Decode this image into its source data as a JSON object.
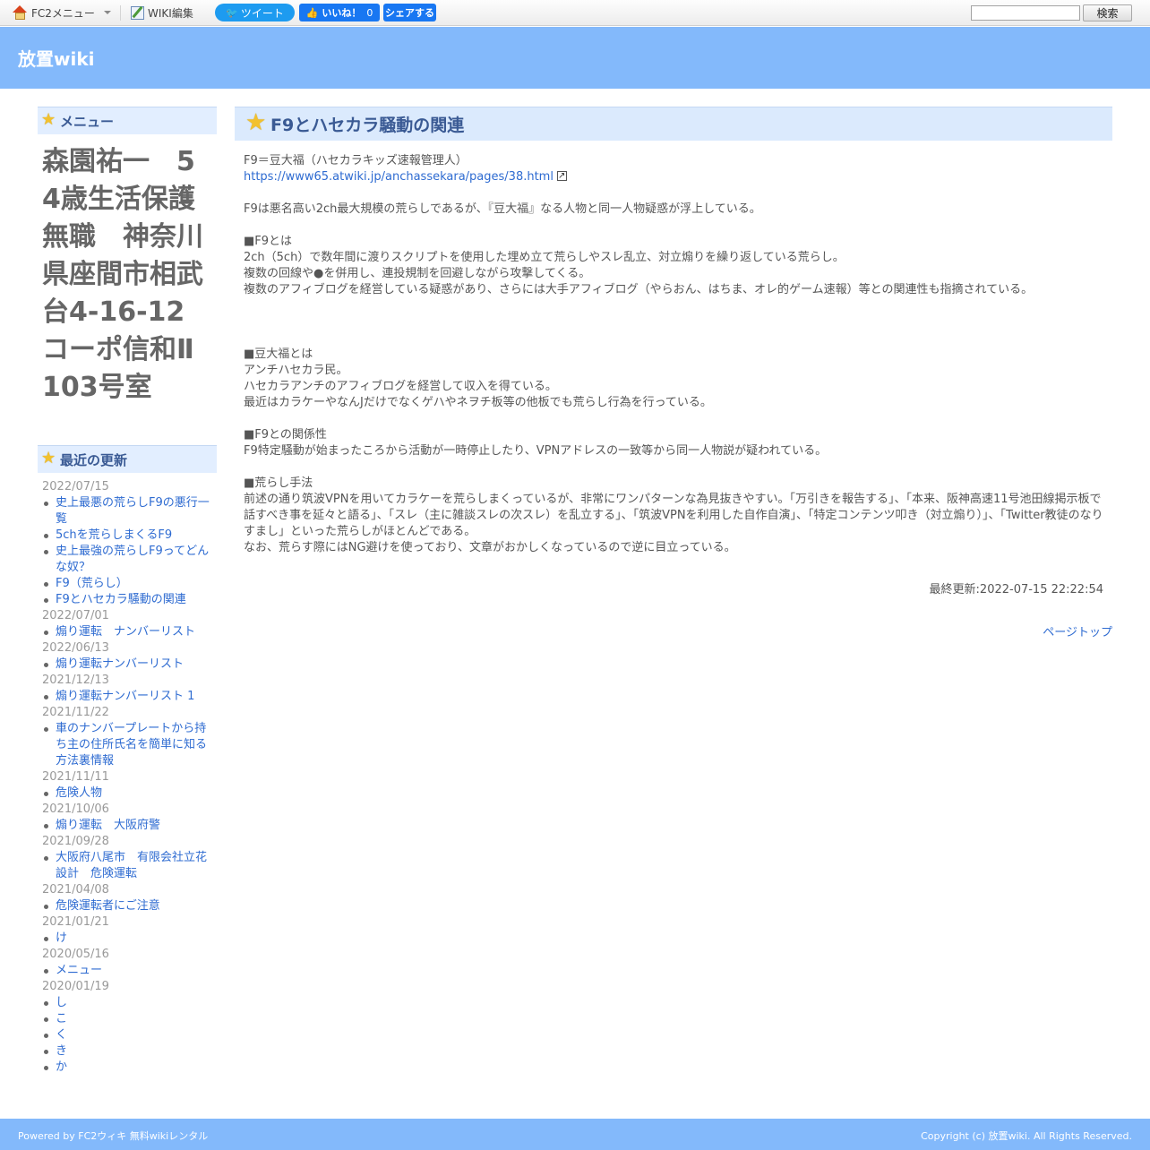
{
  "toolbar": {
    "fc2_menu": "FC2メニュー",
    "wiki_edit": "WIKI編集",
    "tweet": "ツイート",
    "like": "いいね！",
    "like_count": "0",
    "share": "シェアする",
    "search_placeholder": "",
    "search_button": "検索"
  },
  "header": {
    "site_title": "放置wiki"
  },
  "sidebar": {
    "menu_heading": "メニュー",
    "menu_text": "森園祐一　54歳生活保護無職　神奈川県座間市相武台4-16-12　コーポ信和Ⅱ103号室",
    "recent_heading": "最近の更新",
    "recent": [
      {
        "date": "2022/07/15",
        "items": [
          "史上最悪の荒らしF9の悪行一覧",
          "5chを荒らしまくるF9",
          "史上最強の荒らしF9ってどんな奴？",
          "F9（荒らし）",
          "F9とハセカラ騒動の関連"
        ]
      },
      {
        "date": "2022/07/01",
        "items": [
          "煽り運転　ナンバーリスト"
        ]
      },
      {
        "date": "2022/06/13",
        "items": [
          "煽り運転ナンバーリスト"
        ]
      },
      {
        "date": "2021/12/13",
        "items": [
          "煽り運転ナンバーリスト 1"
        ]
      },
      {
        "date": "2021/11/22",
        "items": [
          "車のナンバープレートから持ち主の住所氏名を簡単に知る方法裏情報"
        ]
      },
      {
        "date": "2021/11/11",
        "items": [
          "危険人物"
        ]
      },
      {
        "date": "2021/10/06",
        "items": [
          "煽り運転　大阪府警"
        ]
      },
      {
        "date": "2021/09/28",
        "items": [
          "大阪府八尾市　有限会社立花設計　危険運転"
        ]
      },
      {
        "date": "2021/04/08",
        "items": [
          "危険運転者にご注意"
        ]
      },
      {
        "date": "2021/01/21",
        "items": [
          "け"
        ]
      },
      {
        "date": "2020/05/16",
        "items": [
          "メニュー"
        ]
      },
      {
        "date": "2020/01/19",
        "items": [
          "し",
          "こ",
          "く",
          "き",
          "か"
        ]
      }
    ]
  },
  "main": {
    "page_title": "F9とハセカラ騒動の関連",
    "lines": [
      "F9＝豆大福（ハセカラキッズ速報管理人）",
      "",
      "",
      "F9は悪名高い2ch最大規模の荒らしであるが、『豆大福』なる人物と同一人物疑惑が浮上している。",
      "",
      "■F9とは",
      "2ch（5ch）で数年間に渡りスクリプトを使用した埋め立て荒らしやスレ乱立、対立煽りを繰り返している荒らし。",
      "複数の回線や●を併用し、連投規制を回避しながら攻撃してくる。",
      "複数のアフィブログを経営している疑惑があり、さらには大手アフィブログ（やらおん、はちま、オレ的ゲーム速報）等との関連性も指摘されている。",
      "",
      "",
      "",
      "■豆大福とは",
      "アンチハセカラ民。",
      "ハセカラアンチのアフィブログを経営して収入を得ている。",
      "最近はカラケーやなんJだけでなくゲハやネヲチ板等の他板でも荒らし行為を行っている。",
      "",
      "■F9との関係性",
      "F9特定騒動が始まったころから活動が一時停止したり、VPNアドレスの一致等から同一人物説が疑われている。",
      "",
      "■荒らし手法",
      "前述の通り筑波VPNを用いてカラケーを荒らしまくっているが、非常にワンパターンな為見抜きやすい。「万引きを報告する」、「本来、阪神高速11号池田線掲示板で話すべき事を延々と語る」、「スレ（主に雑談スレの次スレ）を乱立する」、「筑波VPNを利用した自作自演」、「特定コンテンツ叩き（対立煽り）」、「Twitter教徒のなりすまし」といった荒らしがほとんどである。",
      "なお、荒らす際にはNG避けを使っており、文章がおかしくなっているので逆に目立っている。"
    ],
    "link_url": "https://www65.atwiki.jp/anchassekara/pages/38.html",
    "last_updated": "最終更新:2022-07-15 22:22:54",
    "page_top": "ページトップ"
  },
  "footer": {
    "left": "Powered by FC2ウィキ 無料wikiレンタル",
    "right": "Copyright (c) 放置wiki. All Rights Reserved."
  }
}
